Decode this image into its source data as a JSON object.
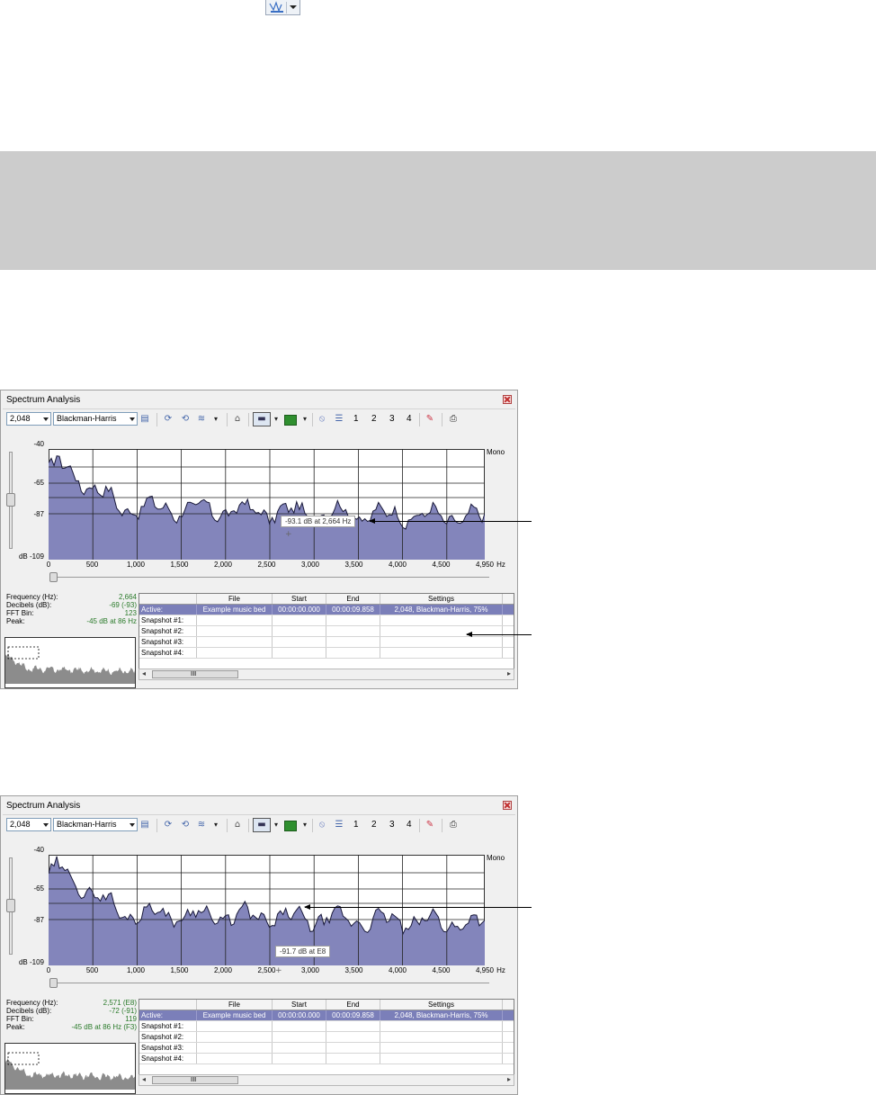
{
  "top_button": {
    "icon": "spectrum-send-icon"
  },
  "windows": [
    {
      "title": "Spectrum Analysis",
      "toolbar": {
        "fft_size": "2,048",
        "window_type": "Blackman-Harris",
        "snapshots": [
          "1",
          "2",
          "3",
          "4"
        ]
      },
      "y_labels": [
        "-40",
        "-65",
        "-87",
        "dB -109"
      ],
      "x_labels": [
        "0",
        "500",
        "1,000",
        "1,500",
        "2,000",
        "2,500",
        "3,000",
        "3,500",
        "4,000",
        "4,500",
        "4,950"
      ],
      "x_unit": "Hz",
      "channel": "Mono",
      "tooltip": "-93.1 dB at 2,664 Hz",
      "info": [
        {
          "key": "Frequency (Hz):",
          "value": "2,664"
        },
        {
          "key": "Decibels (dB):",
          "value": "-69 (-93)"
        },
        {
          "key": "FFT Bin:",
          "value": "123"
        },
        {
          "key": "Peak:",
          "value": "-45 dB at 86 Hz"
        }
      ],
      "table": {
        "headers": [
          "",
          "File",
          "Start",
          "End",
          "Settings"
        ],
        "rows": [
          [
            "Active:",
            "Example music bed",
            "00:00:00.000",
            "00:00:09.858",
            "2,048, Blackman-Harris, 75%"
          ],
          [
            "Snapshot #1:",
            "",
            "",
            "",
            ""
          ],
          [
            "Snapshot #2:",
            "",
            "",
            "",
            ""
          ],
          [
            "Snapshot #3:",
            "",
            "",
            "",
            ""
          ],
          [
            "Snapshot #4:",
            "",
            "",
            "",
            ""
          ]
        ]
      },
      "scroll_thumb_label": "III"
    },
    {
      "title": "Spectrum Analysis",
      "toolbar": {
        "fft_size": "2,048",
        "window_type": "Blackman-Harris",
        "snapshots": [
          "1",
          "2",
          "3",
          "4"
        ]
      },
      "y_labels": [
        "-40",
        "-65",
        "-87",
        "dB -109"
      ],
      "x_labels": [
        "0",
        "500",
        "1,000",
        "1,500",
        "2,000",
        "2,500",
        "3,000",
        "3,500",
        "4,000",
        "4,500",
        "4,950"
      ],
      "x_unit": "Hz",
      "channel": "Mono",
      "tooltip": "-91.7 dB at E8",
      "info": [
        {
          "key": "Frequency (Hz):",
          "value": "2,571 (E8)"
        },
        {
          "key": "Decibels (dB):",
          "value": "-72 (-91)"
        },
        {
          "key": "FFT Bin:",
          "value": "119"
        },
        {
          "key": "Peak:",
          "value": "-45 dB at 86 Hz (F3)"
        }
      ],
      "table": {
        "headers": [
          "",
          "File",
          "Start",
          "End",
          "Settings"
        ],
        "rows": [
          [
            "Active:",
            "Example music bed",
            "00:00:00.000",
            "00:00:09.858",
            "2,048, Blackman-Harris, 75%"
          ],
          [
            "Snapshot #1:",
            "",
            "",
            "",
            ""
          ],
          [
            "Snapshot #2:",
            "",
            "",
            "",
            ""
          ],
          [
            "Snapshot #3:",
            "",
            "",
            "",
            ""
          ],
          [
            "Snapshot #4:",
            "",
            "",
            "",
            ""
          ]
        ]
      },
      "scroll_thumb_label": "III"
    }
  ],
  "colors": {
    "spectrum_fill": "#8385bb",
    "spectrum_line": "#1a1a3a",
    "active_row": "#7b7fb9",
    "info_value": "#2a7a2a"
  }
}
